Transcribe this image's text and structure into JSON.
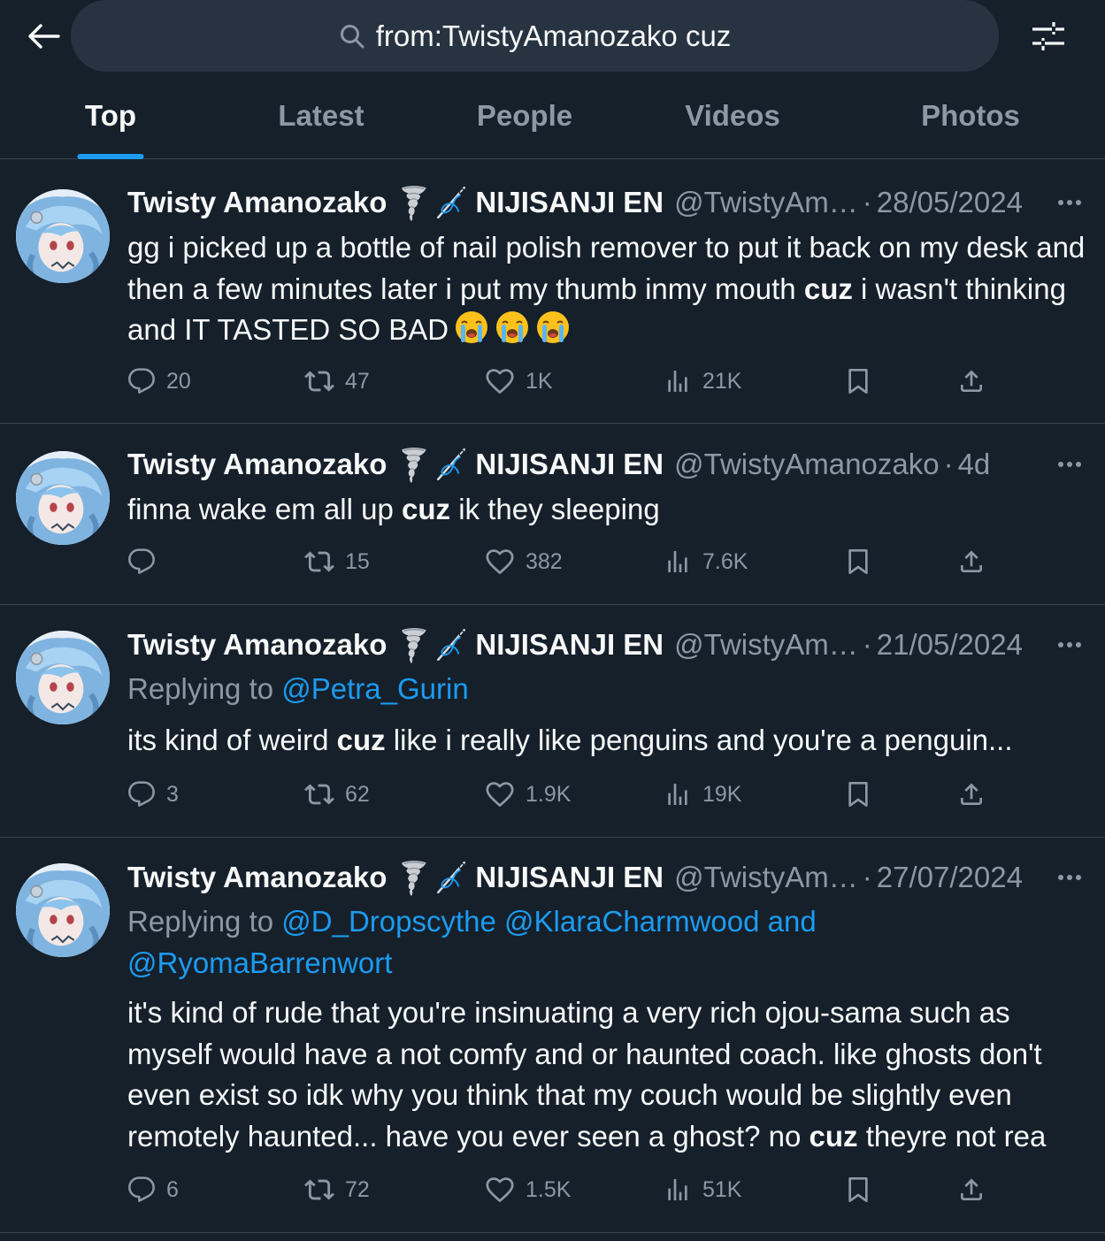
{
  "search": {
    "query": "from:TwistyAmanozako cuz"
  },
  "tabs": [
    {
      "label": "Top",
      "active": true
    },
    {
      "label": "Latest"
    },
    {
      "label": "People"
    },
    {
      "label": "Videos"
    },
    {
      "label": "Photos"
    }
  ],
  "colors": {
    "background": "#15202b",
    "accent": "#1d9bf0",
    "muted": "#8b98a5",
    "divider": "#38444d"
  },
  "tweets": [
    {
      "name": "Twisty Amanozako",
      "org": "NIJISANJI EN",
      "handle": "@TwistyAm…",
      "sep": "·",
      "time": "28/05/2024",
      "text_parts": [
        "gg i picked up a bottle of nail polish remover to put it back on my desk and then a few minutes later i put my thumb inmy mouth ",
        "cuz",
        " i wasn't thinking and IT TASTED SO BAD"
      ],
      "emoji": "loudly-crying-face x3",
      "replies": "20",
      "retweets": "47",
      "likes": "1K",
      "views": "21K"
    },
    {
      "name": "Twisty Amanozako",
      "org": "NIJISANJI EN",
      "handle": "@TwistyAmanozako",
      "sep": "·",
      "time": "4d",
      "text_parts": [
        "finna wake em all up ",
        "cuz",
        " ik they sleeping"
      ],
      "replies": "",
      "retweets": "15",
      "likes": "382",
      "views": "7.6K"
    },
    {
      "name": "Twisty Amanozako",
      "org": "NIJISANJI EN",
      "handle": "@TwistyAm…",
      "sep": "·",
      "time": "21/05/2024",
      "replying_label": "Replying to ",
      "replying_line1": "@Petra_Gurin",
      "text_parts": [
        "its kind of weird ",
        "cuz",
        " like i really like penguins and you're a penguin..."
      ],
      "replies": "3",
      "retweets": "62",
      "likes": "1.9K",
      "views": "19K"
    },
    {
      "name": "Twisty Amanozako",
      "org": "NIJISANJI EN",
      "handle": "@TwistyAm…",
      "sep": "·",
      "time": "27/07/2024",
      "replying_label": "Replying to ",
      "replying_line1": "@D_Dropscythe @KlaraCharmwood and",
      "replying_line2": "@RyomaBarrenwort",
      "text_parts": [
        "it's kind of rude that you're insinuating a very rich ojou-sama such as myself would have a not comfy and or haunted coach. like ghosts don't even exist so idk why you think that my couch would be slightly even remotely haunted... have you ever seen a ghost? no ",
        "cuz",
        " theyre not rea"
      ],
      "replies": "6",
      "retweets": "72",
      "likes": "1.5K",
      "views": "51K"
    }
  ]
}
